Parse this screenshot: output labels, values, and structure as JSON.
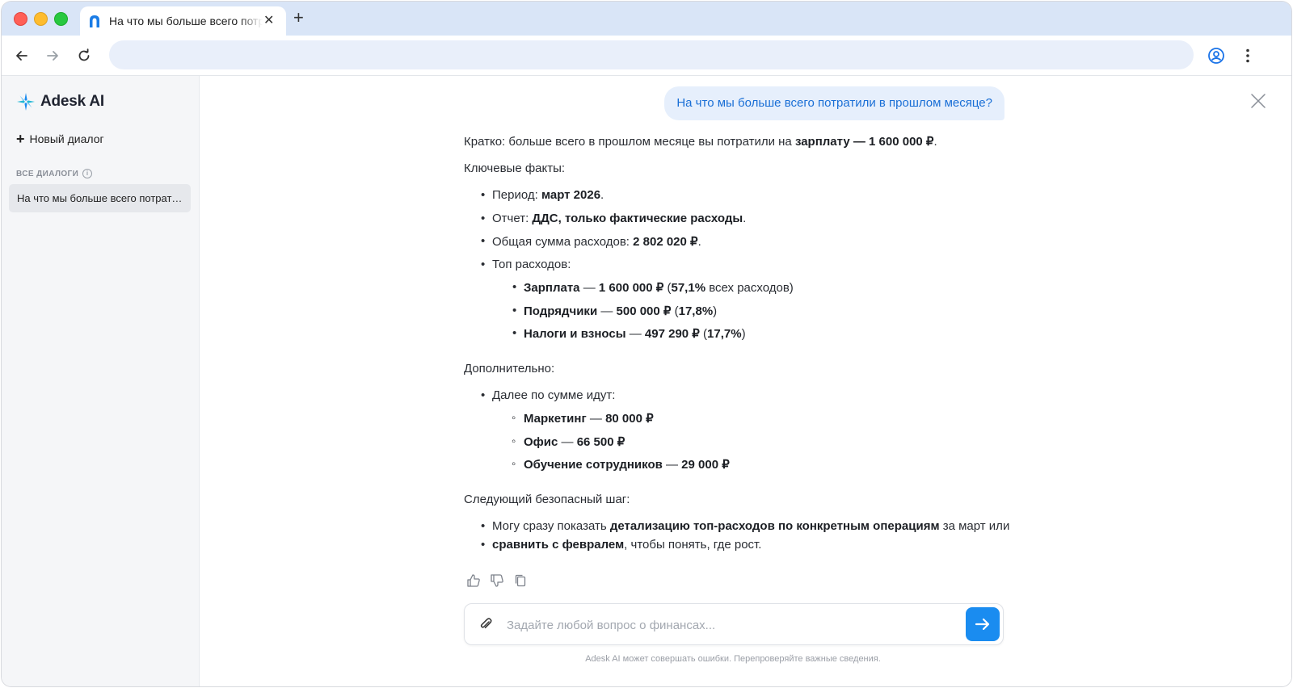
{
  "browser": {
    "tab_title": "На что мы больше всего потратили в прошлом месяце?",
    "tab_close": "✕",
    "new_tab": "+",
    "address": ""
  },
  "sidebar": {
    "logo": "Adesk AI",
    "new_dialog": "Новый диалог",
    "section_label": "ВСЕ ДИАЛОГИ",
    "dialogs": [
      {
        "title": "На что мы больше всего потратили в прошлом месяце?"
      }
    ]
  },
  "chat": {
    "user_message": "На что мы больше всего потратили в прошлом месяце?",
    "answer": {
      "summary_prefix": "Кратко: больше всего в прошлом месяце вы потратили на ",
      "summary_bold": "зарплату — 1 600 000 ₽",
      "summary_suffix": ".",
      "key_facts_heading": "Ключевые факты:",
      "facts": [
        {
          "label": "Период: ",
          "value": "март 2026",
          "end": "."
        },
        {
          "label": "Отчет: ",
          "value": "ДДС, только фактические расходы",
          "end": "."
        },
        {
          "label": "Общая сумма расходов: ",
          "value": "2 802 020 ₽",
          "end": "."
        },
        {
          "label": "Топ расходов:",
          "value": "",
          "end": ""
        }
      ],
      "top_expenses": [
        {
          "name": "Зарплата",
          "sep": " — ",
          "amount": "1 600 000 ₽",
          "open": " (",
          "pct": "57,1%",
          "tail": " всех расходов)"
        },
        {
          "name": "Подрядчики",
          "sep": " — ",
          "amount": "500 000 ₽",
          "open": " (",
          "pct": "17,8%",
          "tail": ")"
        },
        {
          "name": "Налоги и взносы",
          "sep": " — ",
          "amount": "497 290 ₽",
          "open": " (",
          "pct": "17,7%",
          "tail": ")"
        }
      ],
      "additional_heading": "Дополнительно:",
      "additional_item": "Далее по сумме идут:",
      "other_expenses": [
        {
          "name": "Маркетинг",
          "sep": " — ",
          "amount": "80 000 ₽"
        },
        {
          "name": "Офис",
          "sep": " — ",
          "amount": "66 500 ₽"
        },
        {
          "name": "Обучение сотрудников",
          "sep": " — ",
          "amount": "29 000 ₽"
        }
      ],
      "next_step_heading": "Следующий безопасный шаг:",
      "next_step": {
        "p1": "Могу сразу показать ",
        "b1": "детализацию топ-расходов по конкретным операциям",
        "p2": " за март или",
        "b2": "сравнить с февралем",
        "p3": ", чтобы понять, где рост."
      }
    },
    "composer_placeholder": "Задайте любой вопрос о финансах...",
    "disclaimer": "Adesk AI может совершать ошибки. Перепроверяйте важные сведения."
  },
  "colors": {
    "accent": "#1a8cf0",
    "user_bubble_bg": "#e6effc",
    "user_bubble_text": "#1a6fd6",
    "tab_strip": "#d9e5f7"
  }
}
